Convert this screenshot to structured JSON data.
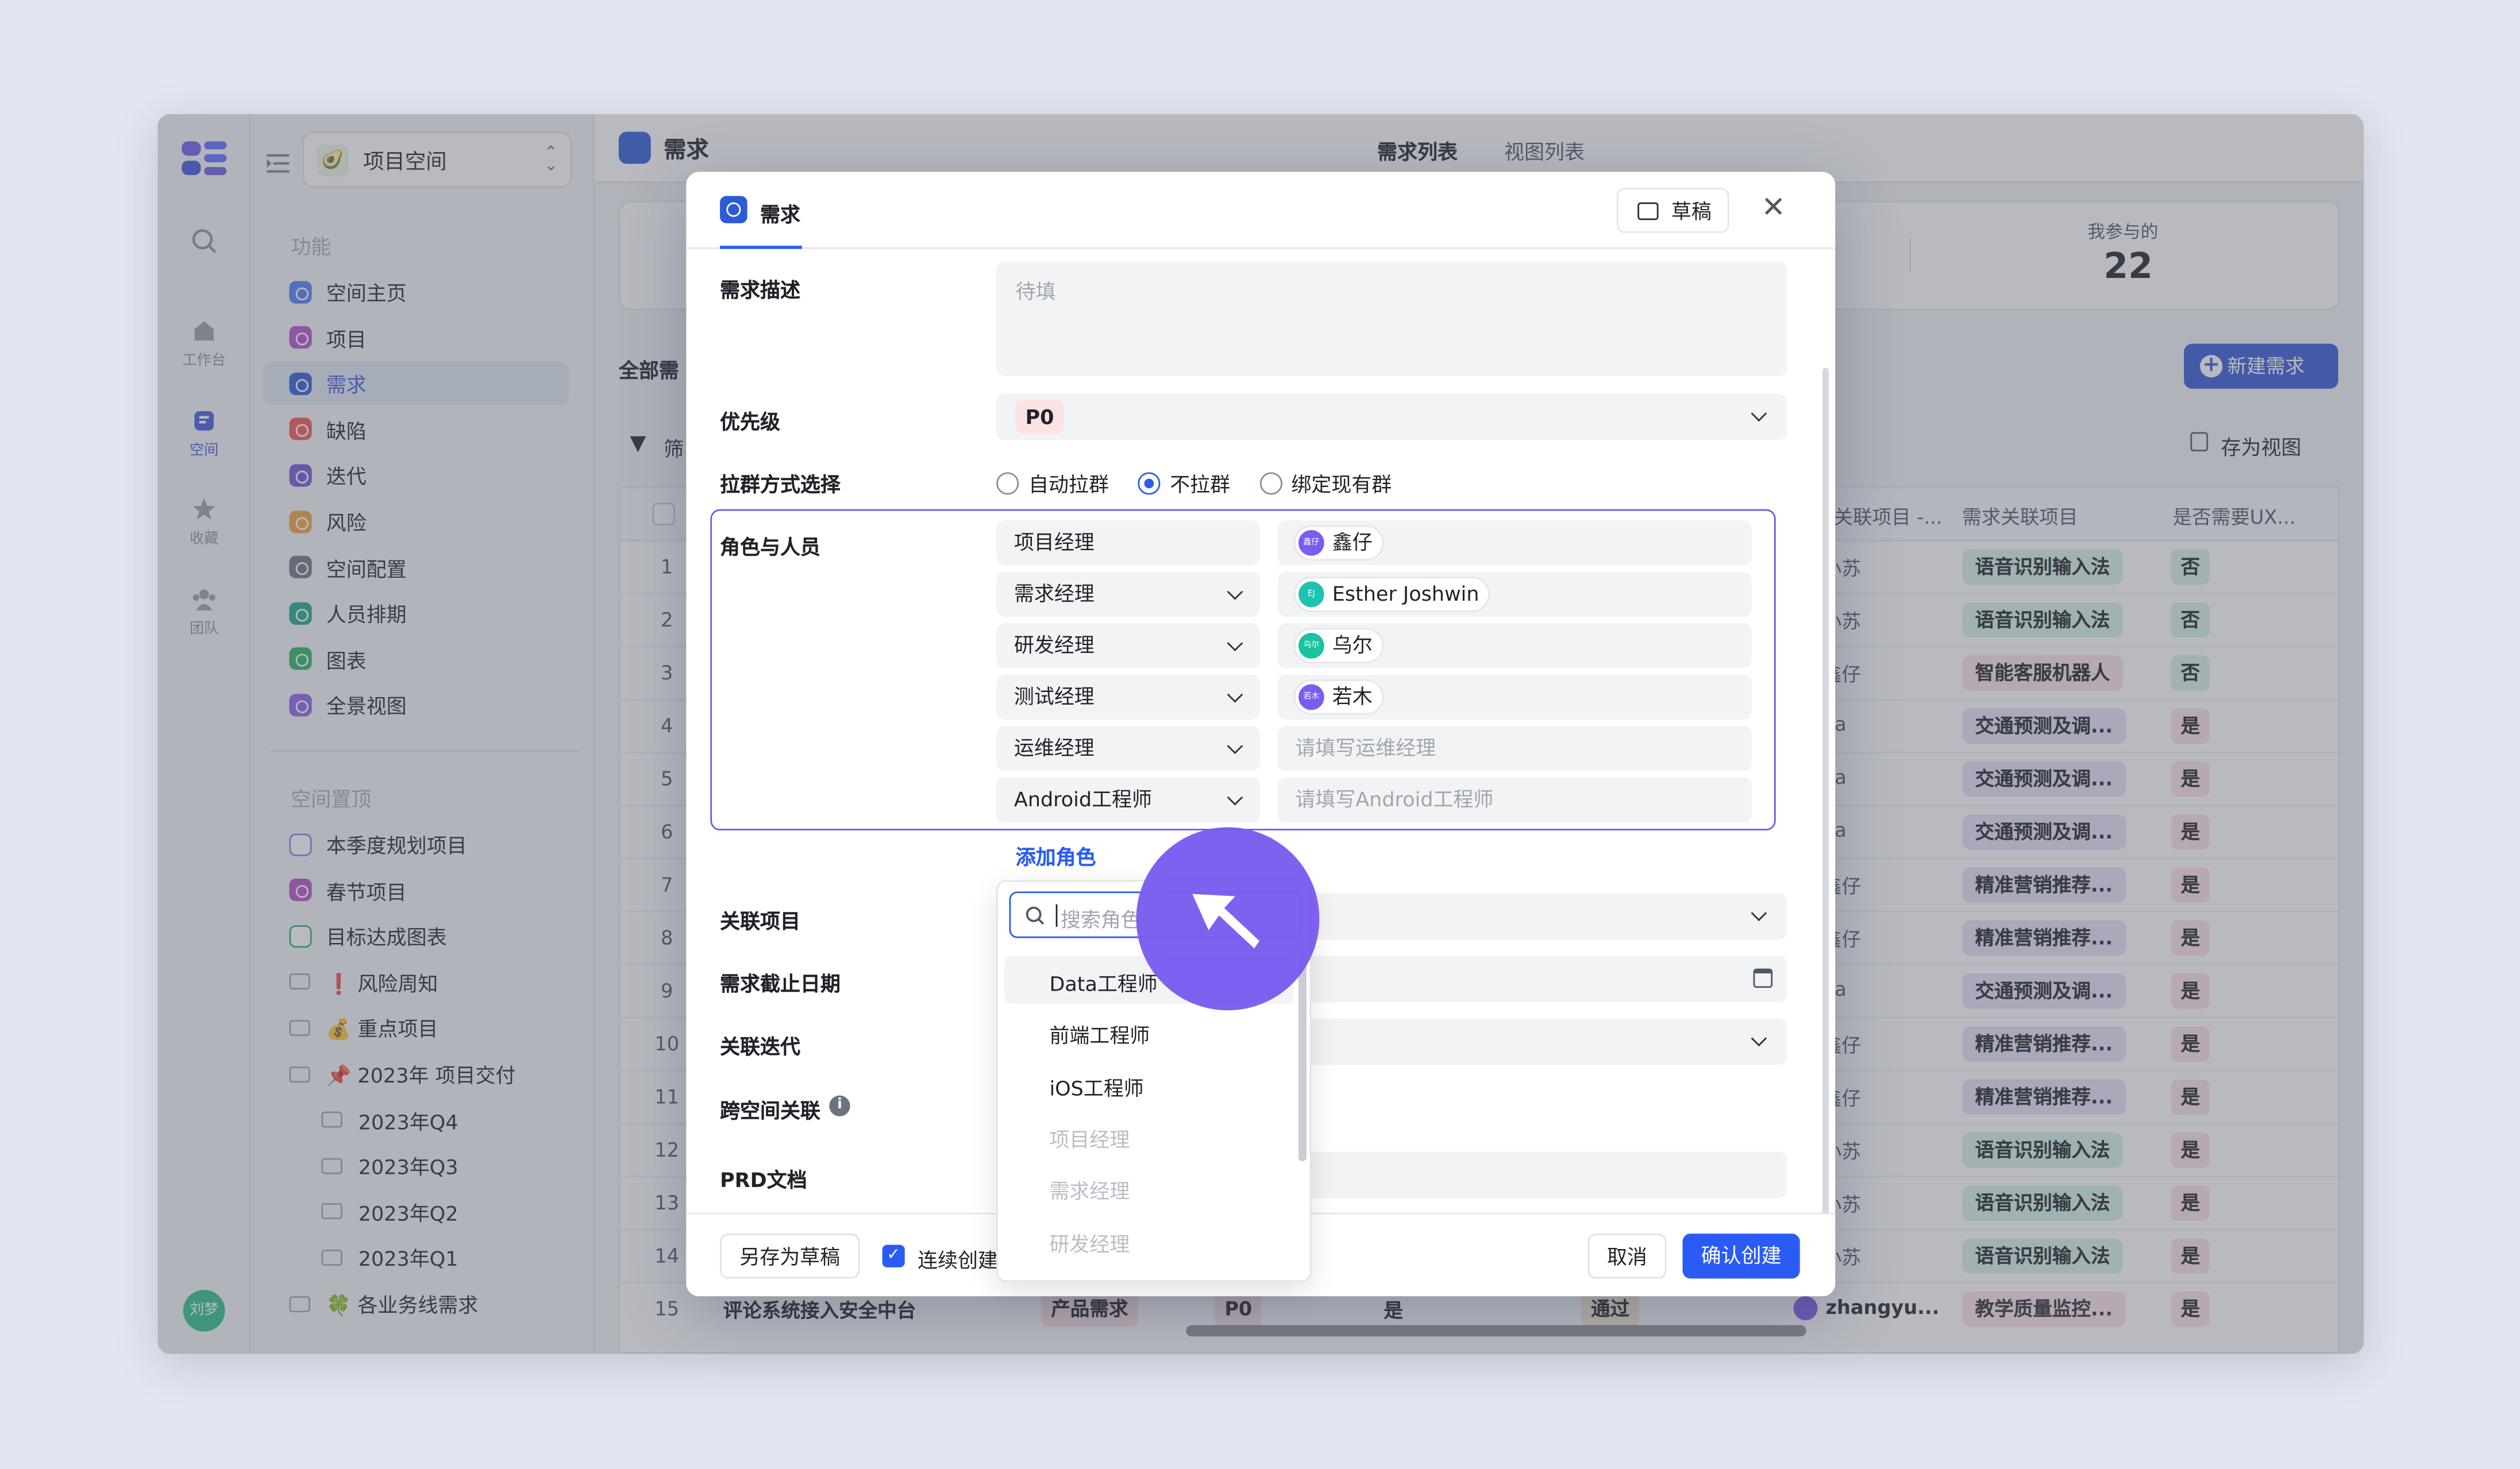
{
  "rail": {
    "items": [
      {
        "label": "工作台",
        "icon": "home-icon"
      },
      {
        "label": "空间",
        "icon": "space-icon"
      },
      {
        "label": "收藏",
        "icon": "star-icon"
      },
      {
        "label": "团队",
        "icon": "team-icon"
      }
    ],
    "avatar": "刘梦"
  },
  "sidebar": {
    "space_name": "项目空间",
    "functions_title": "功能",
    "functions": [
      {
        "label": "空间主页",
        "color": "#4F7CF7"
      },
      {
        "label": "项目",
        "color": "#B34FCB"
      },
      {
        "label": "需求",
        "color": "#2D5BD7",
        "active": true
      },
      {
        "label": "缺陷",
        "color": "#F2554F"
      },
      {
        "label": "迭代",
        "color": "#6E57D9"
      },
      {
        "label": "风险",
        "color": "#F5A03C"
      },
      {
        "label": "空间配置",
        "color": "#6B7280"
      },
      {
        "label": "人员排期",
        "color": "#1DA88C"
      },
      {
        "label": "图表",
        "color": "#27B35E"
      },
      {
        "label": "全景视图",
        "color": "#8A62E8"
      }
    ],
    "pinned_title": "空间置顶",
    "pinned": [
      {
        "label": "本季度规划项目",
        "kind": "list"
      },
      {
        "label": "春节项目",
        "kind": "project"
      },
      {
        "label": "目标达成图表",
        "kind": "chart"
      },
      {
        "label": "❗ 风险周知",
        "kind": "folder"
      },
      {
        "label": "💰 重点项目",
        "kind": "folder"
      },
      {
        "label": "📌 2023年 项目交付",
        "kind": "folder"
      },
      {
        "label": "2023年Q4",
        "kind": "subfolder"
      },
      {
        "label": "2023年Q3",
        "kind": "subfolder"
      },
      {
        "label": "2023年Q2",
        "kind": "subfolder"
      },
      {
        "label": "2023年Q1",
        "kind": "subfolder"
      },
      {
        "label": "🍀 各业务线需求",
        "kind": "folder"
      }
    ]
  },
  "page": {
    "title": "需求",
    "tabs": [
      "需求列表",
      "视图列表"
    ],
    "stat_label": "我参与的",
    "stat_value": "22",
    "all_tab": "全部需",
    "new_button": "新建需求",
    "filter_label": "筛",
    "save_view": "存为视图",
    "columns": [
      "关联项目 -...",
      "需求关联项目",
      "是否需要UX..."
    ]
  },
  "table_rows": [
    {
      "num": "1",
      "owner": "小苏",
      "project": "语音识别输入法",
      "pcolor": "green",
      "ux": "否"
    },
    {
      "num": "2",
      "owner": "小苏",
      "project": "语音识别输入法",
      "pcolor": "green",
      "ux": "否"
    },
    {
      "num": "3",
      "owner": "鑫仔",
      "project": "智能客服机器人",
      "pcolor": "pink",
      "ux": "否"
    },
    {
      "num": "4",
      "owner": "ha",
      "project": "交通预测及调...",
      "pcolor": "purple",
      "ux": "是"
    },
    {
      "num": "5",
      "owner": "ha",
      "project": "交通预测及调...",
      "pcolor": "purple",
      "ux": "是"
    },
    {
      "num": "6",
      "owner": "ha",
      "project": "交通预测及调...",
      "pcolor": "purple",
      "ux": "是"
    },
    {
      "num": "7",
      "owner": "鑫仔",
      "project": "精准营销推荐...",
      "pcolor": "purple",
      "ux": "是"
    },
    {
      "num": "8",
      "owner": "鑫仔",
      "project": "精准营销推荐...",
      "pcolor": "purple",
      "ux": "是"
    },
    {
      "num": "9",
      "owner": "ha",
      "project": "交通预测及调...",
      "pcolor": "purple",
      "ux": "是"
    },
    {
      "num": "10",
      "owner": "鑫仔",
      "project": "精准营销推荐...",
      "pcolor": "purple",
      "ux": "是"
    },
    {
      "num": "11",
      "owner": "鑫仔",
      "project": "精准营销推荐...",
      "pcolor": "purple",
      "ux": "是"
    },
    {
      "num": "12",
      "owner": "小苏",
      "project": "语音识别输入法",
      "pcolor": "green",
      "ux": "是"
    },
    {
      "num": "13",
      "owner": "小苏",
      "project": "语音识别输入法",
      "pcolor": "green",
      "ux": "是"
    },
    {
      "num": "14",
      "owner": "小苏",
      "project": "语音识别输入法",
      "pcolor": "green",
      "ux": "是"
    }
  ],
  "last_row": {
    "num": "15",
    "title": "评论系统接入安全中台",
    "type": "产品需求",
    "priority": "P0",
    "flag": "是",
    "status": "通过",
    "owner": "zhangyu...",
    "project": "教学质量监控...",
    "ux": "是"
  },
  "modal": {
    "tab_title": "需求",
    "draft_button": "草稿",
    "desc_label": "需求描述",
    "desc_placeholder": "待填",
    "priority_label": "优先级",
    "priority_value": "P0",
    "group_label": "拉群方式选择",
    "group_options": [
      "自动拉群",
      "不拉群",
      "绑定现有群"
    ],
    "group_selected": "不拉群",
    "roles_label": "角色与人员",
    "roles": [
      {
        "role": "项目经理",
        "person": "鑫仔",
        "avatar_text": "鑫仔",
        "avatar_color": "#7B5CF0",
        "has_dropdown": false
      },
      {
        "role": "需求经理",
        "person": "Esther Joshwin",
        "avatar_text": "EJ",
        "avatar_color": "#1EC3B0",
        "has_dropdown": true
      },
      {
        "role": "研发经理",
        "person": "乌尔",
        "avatar_text": "乌尔",
        "avatar_color": "#19C2A0",
        "has_dropdown": true
      },
      {
        "role": "测试经理",
        "person": "若木",
        "avatar_text": "若木",
        "avatar_color": "#7B5CF0",
        "has_dropdown": true
      },
      {
        "role": "运维经理",
        "person": "",
        "placeholder": "请填写运维经理",
        "has_dropdown": true
      },
      {
        "role": "Android工程师",
        "person": "",
        "placeholder": "请填写Android工程师",
        "has_dropdown": true
      }
    ],
    "add_role": "添加角色",
    "related_project_label": "关联项目",
    "deadline_label": "需求截止日期",
    "iteration_label": "关联迭代",
    "cross_space_label": "跨空间关联",
    "prd_label": "PRD文档",
    "save_draft": "另存为草稿",
    "continuous_label": "连续创建",
    "cancel": "取消",
    "confirm": "确认创建"
  },
  "role_dropdown": {
    "search_placeholder": "搜索角色",
    "options": [
      {
        "label": "Data工程师",
        "disabled": false
      },
      {
        "label": "前端工程师",
        "disabled": false
      },
      {
        "label": "iOS工程师",
        "disabled": false
      },
      {
        "label": "项目经理",
        "disabled": true
      },
      {
        "label": "需求经理",
        "disabled": true
      },
      {
        "label": "研发经理",
        "disabled": true
      }
    ]
  },
  "colors": {
    "accent": "#2A5CF5",
    "role_border": "#6A5AF0",
    "cursor": "#7B5CF0",
    "nav_button": "#3556D4"
  }
}
